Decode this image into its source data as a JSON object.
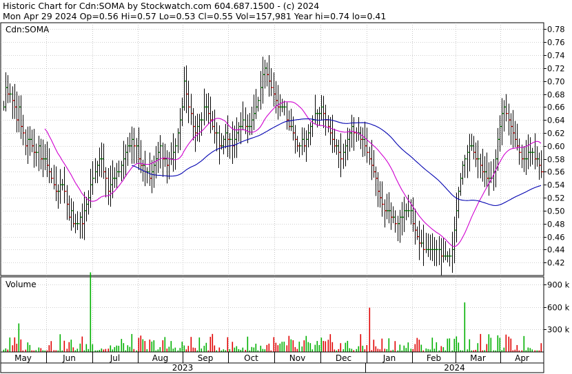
{
  "header": {
    "line1": "Historic Chart for Cdn:SOMA by Stockwatch.com 604.687.1500 - (c) 2024",
    "line2": "Mon Apr 29 2024  Op=0.56  Hi=0.57  Lo=0.53  Cl=0.55  Vol=157,981  Year hi=0.74  lo=0.41"
  },
  "colors": {
    "up": "#008000",
    "down": "#d00000",
    "ma_short": "#d000d0",
    "ma_long": "#0000b0",
    "grid": "#a0a0a0",
    "volume_up": "#00b000",
    "volume_down": "#e00000"
  },
  "chart_data": {
    "type": "ohlc",
    "symbol_label": "Cdn:SOMA",
    "volume_label": "Volume",
    "price_ylim": [
      0.4,
      0.79
    ],
    "price_ticks": [
      "0.78",
      "0.76",
      "0.74",
      "0.72",
      "0.70",
      "0.68",
      "0.66",
      "0.64",
      "0.62",
      "0.60",
      "0.58",
      "0.56",
      "0.54",
      "0.52",
      "0.50",
      "0.48",
      "0.46",
      "0.44",
      "0.42"
    ],
    "volume_ylim": [
      0,
      1000
    ],
    "volume_ticks": [
      "900 k",
      "600 k",
      "300 k"
    ],
    "months": [
      "May",
      "Jun",
      "Jul",
      "Aug",
      "Sep",
      "Oct",
      "Nov",
      "Dec",
      "Jan",
      "Feb",
      "Mar",
      "Apr"
    ],
    "years": [
      "2023",
      "2024"
    ],
    "prices": [
      0.66,
      0.69,
      0.68,
      0.68,
      0.67,
      0.66,
      0.64,
      0.66,
      0.63,
      0.62,
      0.6,
      0.61,
      0.61,
      0.6,
      0.59,
      0.59,
      0.6,
      0.58,
      0.58,
      0.58,
      0.57,
      0.56,
      0.55,
      0.54,
      0.53,
      0.53,
      0.54,
      0.54,
      0.53,
      0.51,
      0.49,
      0.5,
      0.48,
      0.48,
      0.48,
      0.49,
      0.48,
      0.5,
      0.51,
      0.52,
      0.54,
      0.55,
      0.56,
      0.57,
      0.58,
      0.58,
      0.56,
      0.55,
      0.53,
      0.54,
      0.55,
      0.55,
      0.56,
      0.56,
      0.57,
      0.58,
      0.59,
      0.6,
      0.6,
      0.61,
      0.6,
      0.6,
      0.58,
      0.57,
      0.57,
      0.56,
      0.56,
      0.55,
      0.56,
      0.57,
      0.58,
      0.59,
      0.6,
      0.58,
      0.58,
      0.57,
      0.58,
      0.58,
      0.59,
      0.6,
      0.62,
      0.64,
      0.66,
      0.7,
      0.68,
      0.66,
      0.65,
      0.63,
      0.62,
      0.63,
      0.64,
      0.64,
      0.66,
      0.66,
      0.65,
      0.64,
      0.63,
      0.62,
      0.62,
      0.6,
      0.6,
      0.61,
      0.62,
      0.61,
      0.61,
      0.6,
      0.61,
      0.62,
      0.63,
      0.63,
      0.64,
      0.63,
      0.63,
      0.63,
      0.64,
      0.65,
      0.66,
      0.67,
      0.69,
      0.71,
      0.72,
      0.71,
      0.7,
      0.69,
      0.68,
      0.67,
      0.66,
      0.66,
      0.66,
      0.66,
      0.64,
      0.63,
      0.63,
      0.62,
      0.61,
      0.6,
      0.6,
      0.61,
      0.6,
      0.61,
      0.62,
      0.63,
      0.64,
      0.65,
      0.65,
      0.65,
      0.66,
      0.65,
      0.64,
      0.63,
      0.62,
      0.61,
      0.6,
      0.6,
      0.59,
      0.58,
      0.59,
      0.6,
      0.61,
      0.62,
      0.63,
      0.62,
      0.62,
      0.62,
      0.61,
      0.61,
      0.6,
      0.59,
      0.58,
      0.57,
      0.56,
      0.55,
      0.53,
      0.52,
      0.51,
      0.5,
      0.5,
      0.5,
      0.49,
      0.49,
      0.48,
      0.48,
      0.49,
      0.49,
      0.5,
      0.5,
      0.5,
      0.5,
      0.48,
      0.47,
      0.46,
      0.45,
      0.45,
      0.44,
      0.44,
      0.44,
      0.44,
      0.44,
      0.44,
      0.44,
      0.44,
      0.43,
      0.43,
      0.43,
      0.43,
      0.43,
      0.44,
      0.47,
      0.5,
      0.53,
      0.55,
      0.57,
      0.58,
      0.59,
      0.6,
      0.6,
      0.59,
      0.58,
      0.58,
      0.57,
      0.56,
      0.56,
      0.55,
      0.55,
      0.55,
      0.56,
      0.58,
      0.61,
      0.63,
      0.65,
      0.66,
      0.65,
      0.64,
      0.63,
      0.62,
      0.61,
      0.6,
      0.59,
      0.58,
      0.58,
      0.58,
      0.59,
      0.59,
      0.59,
      0.58,
      0.58,
      0.57,
      0.56
    ]
  }
}
